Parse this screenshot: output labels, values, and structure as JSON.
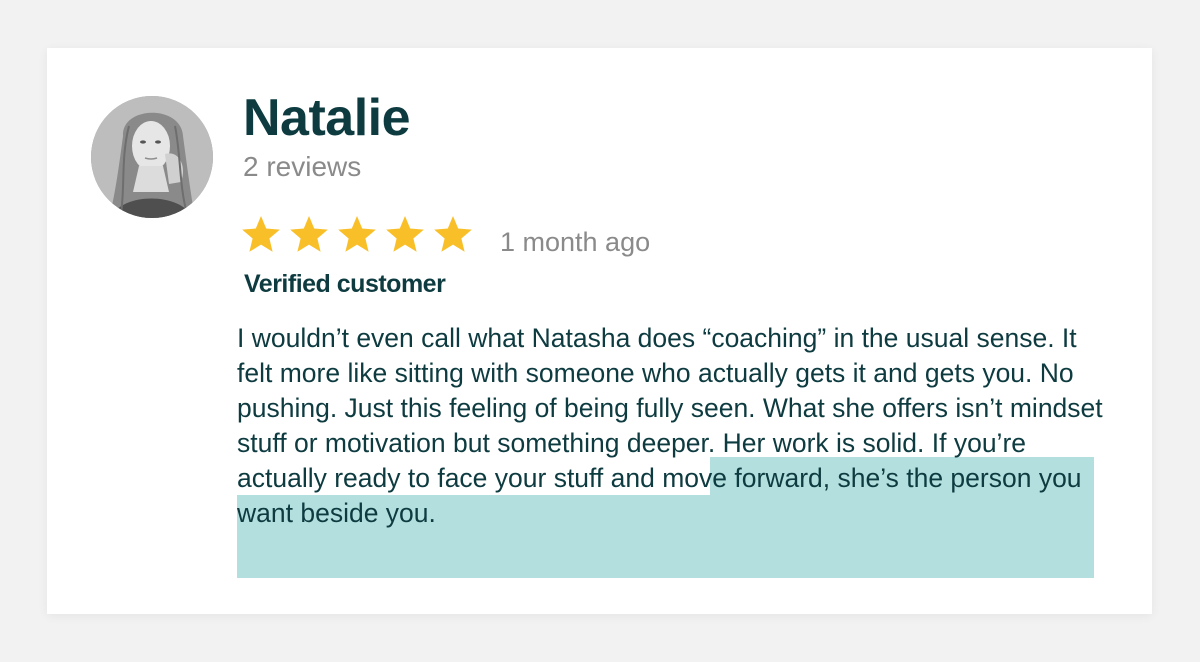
{
  "reviewer": {
    "name": "Natalie",
    "review_count": "2 reviews",
    "avatar_icon": "reviewer-photo"
  },
  "rating": {
    "stars": 5,
    "max_stars": 5,
    "star_color": "#f9bf29",
    "time_ago": "1 month ago"
  },
  "badge": {
    "label": "Verified customer"
  },
  "review": {
    "text_plain": "I wouldn’t even call what Natasha does “coaching” in the usual sense. It felt more like sitting with someone who actually gets it and gets you. No pushing. Just this feeling of being fully seen. What she offers isn’t mindset stuff or motivation but something deeper. ",
    "text_highlighted": "Her work is solid. If you’re actually ready to face your stuff and move forward, she’s the person you want beside you.",
    "highlight_color": "#b3dfde",
    "text_color": "#0d3b40"
  }
}
